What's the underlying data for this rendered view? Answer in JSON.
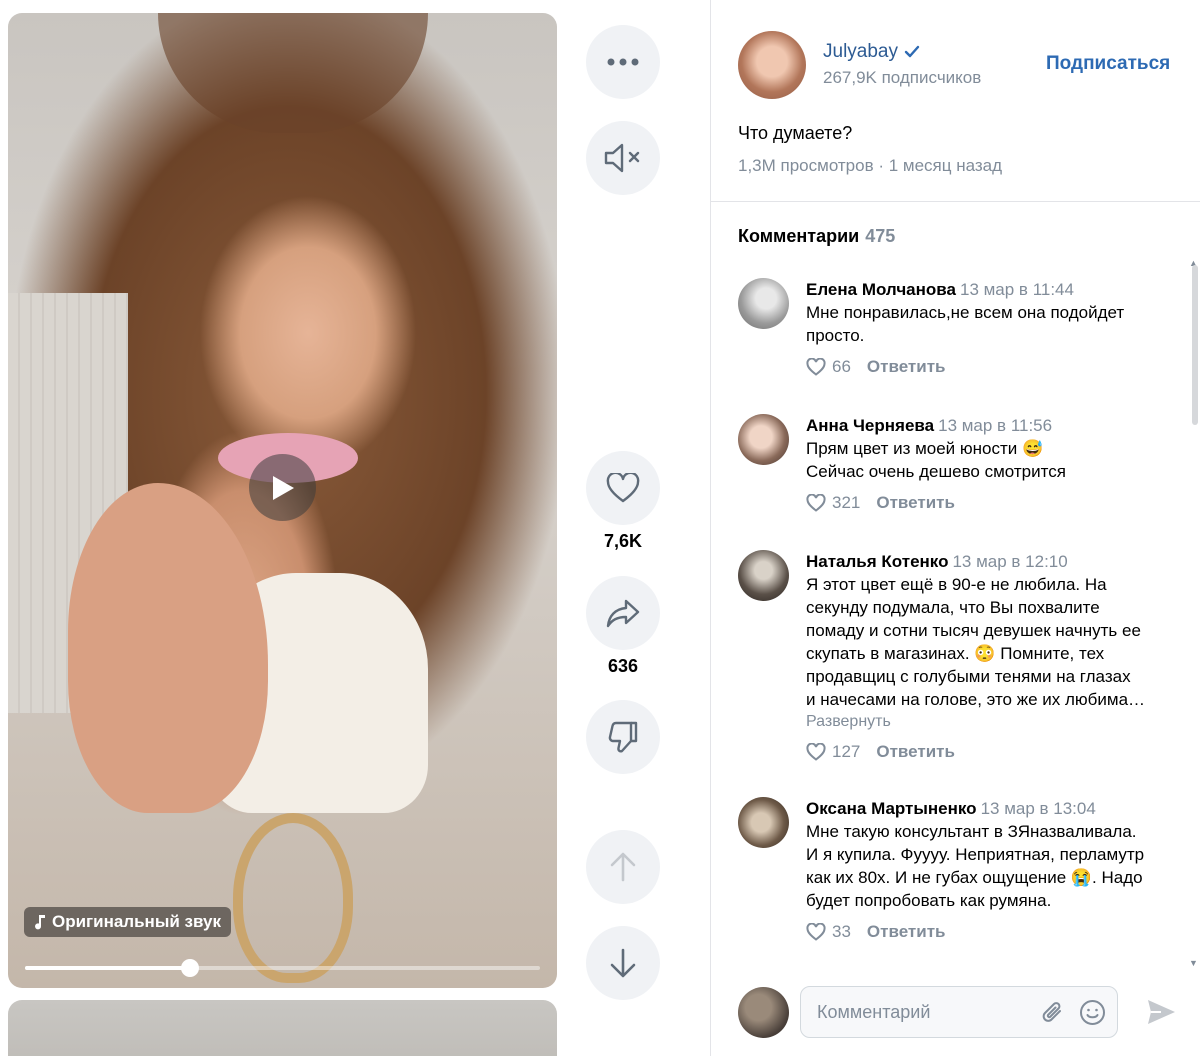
{
  "video": {
    "sound_label": "Оригинальный звук",
    "progress": 0.32
  },
  "actions": {
    "likes": "7,6K",
    "shares": "636"
  },
  "author": {
    "name": "Julyabay",
    "subscribers": "267,9K подписчиков",
    "subscribe_label": "Подписаться"
  },
  "post": {
    "description": "Что думаете?",
    "meta": "1,3M просмотров · 1 месяц назад"
  },
  "comments": {
    "title": "Комментарии",
    "count": "475",
    "reply_label": "Ответить",
    "items": [
      {
        "name": "Елена Молчанова",
        "date": "13 мар в 11:44",
        "lines": [
          "Мне понравилась,не всем она подойдет",
          "просто."
        ],
        "likes": "66"
      },
      {
        "name": "Анна Черняева",
        "date": "13 мар в 11:56",
        "lines": [
          "Прям цвет из моей юности 😅",
          "Сейчас очень дешево смотрится"
        ],
        "likes": "321"
      },
      {
        "name": "Наталья Котенко",
        "date": "13 мар в 12:10",
        "lines": [
          "Я этот цвет ещё в 90-е не любила. На",
          "секунду подумала, что Вы похвалите",
          "помаду и сотни тысяч девушек начнуть ее",
          "скупать в магазинах. 😳 Помните, тех",
          "продавщиц с голубыми тенями на глазах",
          "и начесами на голове, это же их любима…"
        ],
        "expand": "Развернуть",
        "likes": "127"
      },
      {
        "name": "Оксана Мартыненко",
        "date": "13 мар в 13:04",
        "lines": [
          "Мне такую консультант в ЗЯназваливала.",
          "И я купила. Фуууу. Неприятная, перламутр",
          "как их 80х. И не губах ощущение 😭. Надо",
          "будет попробовать как румяна."
        ],
        "likes": "33"
      }
    ]
  },
  "composer": {
    "placeholder": "Комментарий"
  },
  "colors": {
    "link": "#2d5b93",
    "accent": "#2d6ab3",
    "muted": "#818c99",
    "button_bg": "#f0f2f5"
  }
}
